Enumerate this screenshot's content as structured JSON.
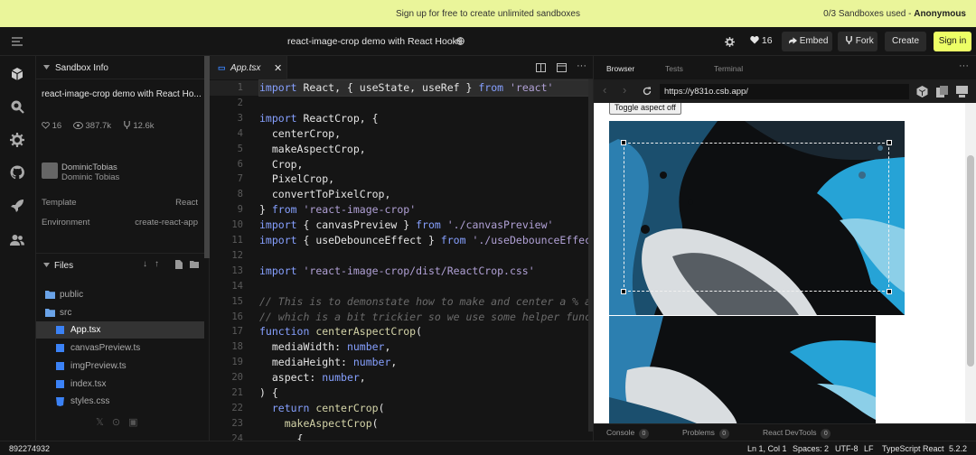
{
  "banner": {
    "message": "Sign up for free to create unlimited sandboxes",
    "usage": "0/3 Sandboxes used - ",
    "plan": "Anonymous"
  },
  "topbar": {
    "title": "react-image-crop demo with React Hooks",
    "likes": "16",
    "embed": "Embed",
    "fork": "Fork",
    "create": "Create",
    "signin": "Sign in"
  },
  "sidebar": {
    "info_header": "Sandbox Info",
    "sandbox_title": "react-image-crop demo with React Ho...",
    "stats": {
      "likes": "16",
      "views": "387.7k",
      "forks": "12.6k"
    },
    "author": {
      "name": "DominicTobias",
      "handle": "Dominic Tobias"
    },
    "template_label": "Template",
    "template_value": "React",
    "env_label": "Environment",
    "env_value": "create-react-app",
    "files_header": "Files",
    "files": [
      {
        "name": "public",
        "kind": "folder"
      },
      {
        "name": "src",
        "kind": "folder"
      },
      {
        "name": "App.tsx",
        "kind": "ts"
      },
      {
        "name": "canvasPreview.ts",
        "kind": "ts"
      },
      {
        "name": "imgPreview.ts",
        "kind": "ts"
      },
      {
        "name": "index.tsx",
        "kind": "ts"
      },
      {
        "name": "styles.css",
        "kind": "css"
      }
    ]
  },
  "editor": {
    "tab": "App.tsx",
    "lines": [
      [
        [
          "k",
          "import"
        ],
        [
          "p",
          " React, { useState, useRef } "
        ],
        [
          "k",
          "from"
        ],
        [
          "p",
          " "
        ],
        [
          "s",
          "'react'"
        ]
      ],
      [],
      [
        [
          "k",
          "import"
        ],
        [
          "p",
          " ReactCrop, {"
        ]
      ],
      [
        [
          "p",
          "  centerCrop,"
        ]
      ],
      [
        [
          "p",
          "  makeAspectCrop,"
        ]
      ],
      [
        [
          "p",
          "  Crop,"
        ]
      ],
      [
        [
          "p",
          "  PixelCrop,"
        ]
      ],
      [
        [
          "p",
          "  convertToPixelCrop,"
        ]
      ],
      [
        [
          "p",
          "} "
        ],
        [
          "k",
          "from"
        ],
        [
          "p",
          " "
        ],
        [
          "s",
          "'react-image-crop'"
        ]
      ],
      [
        [
          "k",
          "import"
        ],
        [
          "p",
          " { canvasPreview } "
        ],
        [
          "k",
          "from"
        ],
        [
          "p",
          " "
        ],
        [
          "s",
          "'./canvasPreview'"
        ]
      ],
      [
        [
          "k",
          "import"
        ],
        [
          "p",
          " { useDebounceEffect } "
        ],
        [
          "k",
          "from"
        ],
        [
          "p",
          " "
        ],
        [
          "s",
          "'./useDebounceEffect'"
        ]
      ],
      [],
      [
        [
          "k",
          "import"
        ],
        [
          "p",
          " "
        ],
        [
          "s",
          "'react-image-crop/dist/ReactCrop.css'"
        ]
      ],
      [],
      [
        [
          "c",
          "// This is to demonstate how to make and center a % asp"
        ]
      ],
      [
        [
          "c",
          "// which is a bit trickier so we use some helper functi"
        ]
      ],
      [
        [
          "k",
          "function"
        ],
        [
          "p",
          " "
        ],
        [
          "f",
          "centerAspectCrop"
        ],
        [
          "p",
          "("
        ]
      ],
      [
        [
          "p",
          "  mediaWidth: "
        ],
        [
          "k",
          "number"
        ],
        [
          "p",
          ","
        ]
      ],
      [
        [
          "p",
          "  mediaHeight: "
        ],
        [
          "k",
          "number"
        ],
        [
          "p",
          ","
        ]
      ],
      [
        [
          "p",
          "  aspect: "
        ],
        [
          "k",
          "number"
        ],
        [
          "p",
          ","
        ]
      ],
      [
        [
          "p",
          ") {"
        ]
      ],
      [
        [
          "p",
          "  "
        ],
        [
          "k",
          "return"
        ],
        [
          "p",
          " "
        ],
        [
          "f",
          "centerCrop"
        ],
        [
          "p",
          "("
        ]
      ],
      [
        [
          "p",
          "    "
        ],
        [
          "f",
          "makeAspectCrop"
        ],
        [
          "p",
          "("
        ]
      ],
      [
        [
          "p",
          "      {"
        ]
      ]
    ]
  },
  "preview": {
    "tabs": [
      "Browser",
      "Tests",
      "Terminal"
    ],
    "url": "https://y831o.csb.app/",
    "aspect_button": "Toggle aspect off",
    "console": [
      {
        "label": "Console",
        "count": "0"
      },
      {
        "label": "Problems",
        "count": "0"
      },
      {
        "label": "React DevTools",
        "count": "0"
      }
    ]
  },
  "status": {
    "id": "892274932",
    "cursor": "Ln 1, Col 1",
    "spaces": "Spaces: 2",
    "encoding": "UTF-8",
    "eol": "LF",
    "language": "TypeScript React",
    "version": "5.2.2"
  },
  "colors": {
    "banner": "#eaf59a",
    "background": "#151515",
    "signin": "#edff66",
    "keyword": "#86a0ff",
    "string": "#b1a1d6"
  }
}
